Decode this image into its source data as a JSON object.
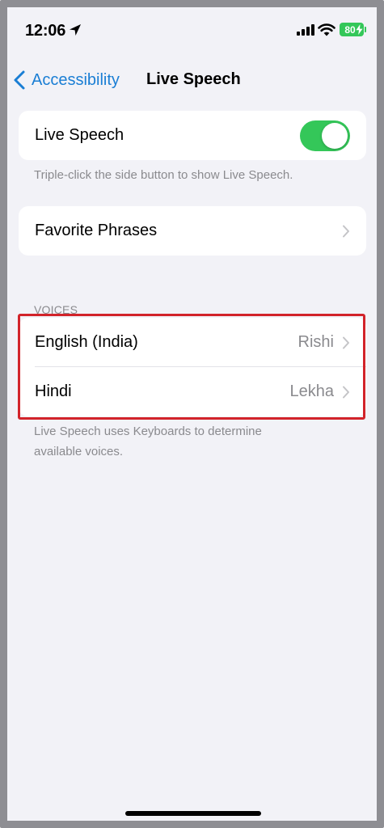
{
  "status_bar": {
    "time": "12:06",
    "battery": "80",
    "battery_color": "#34c759"
  },
  "nav": {
    "back_label": "Accessibility",
    "title": "Live Speech",
    "accent_color": "#1a7ed4"
  },
  "live_speech": {
    "label": "Live Speech",
    "toggle_on": true,
    "footnote": "Triple-click the side button to show Live Speech."
  },
  "favorite_phrases": {
    "label": "Favorite Phrases"
  },
  "voices": {
    "header": "VOICES",
    "items": [
      {
        "label": "English (India)",
        "value": "Rishi"
      },
      {
        "label": "Hindi",
        "value": "Lekha"
      }
    ],
    "footnote": "Live Speech uses Keyboards to determine available voices."
  },
  "icons": [
    "location-arrow-icon",
    "cellular-signal-icon",
    "wifi-icon",
    "battery-icon",
    "back-chevron-icon",
    "chevron-right-icon"
  ]
}
